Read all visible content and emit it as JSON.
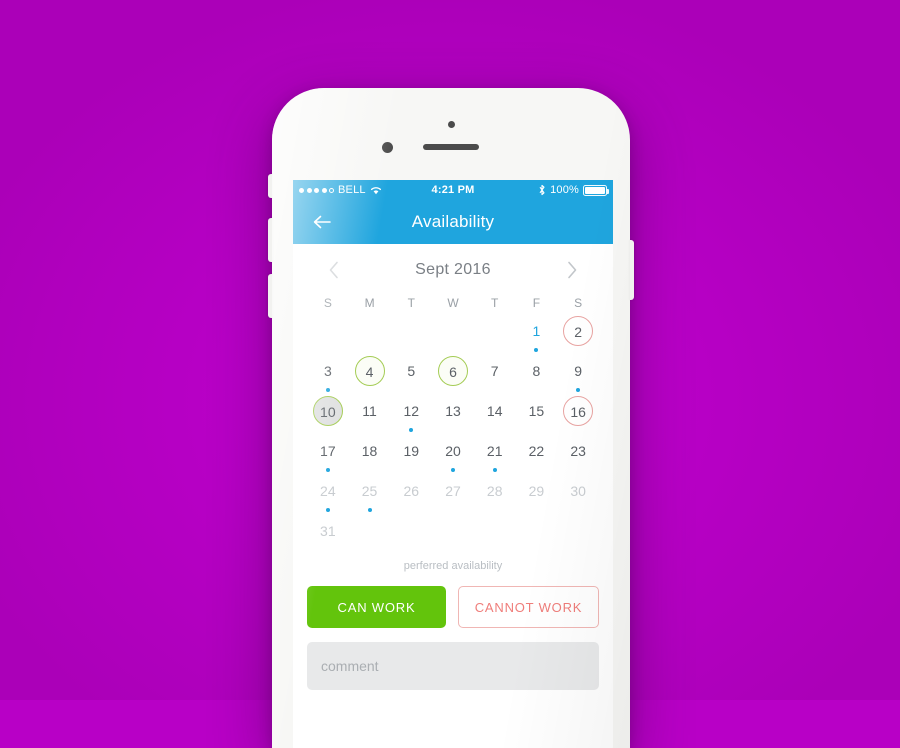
{
  "theme": {
    "background": "#b800c6",
    "accent_blue": "#1fa5de",
    "green": "#63c40c",
    "ring_green": "#a4cc54",
    "ring_red": "#e8a3a1",
    "red_text": "#ef7d7a"
  },
  "status_bar": {
    "carrier": "BELL",
    "signal_filled": 4,
    "signal_hollow": 1,
    "wifi_icon": "wifi-icon",
    "time": "4:21 PM",
    "bluetooth_icon": "bluetooth-icon",
    "battery_percent": "100%",
    "battery_icon": "battery-full-icon"
  },
  "nav_bar": {
    "back_icon": "arrow-left-icon",
    "title": "Availability"
  },
  "calendar": {
    "prev_icon": "chevron-left-icon",
    "next_icon": "chevron-right-icon",
    "month_label": "Sept 2016",
    "weekdays": [
      "S",
      "M",
      "T",
      "W",
      "T",
      "F",
      "S"
    ],
    "legend": "perferred availability",
    "days": [
      {
        "num": "",
        "blank": true
      },
      {
        "num": "",
        "blank": true
      },
      {
        "num": "",
        "blank": true
      },
      {
        "num": "",
        "blank": true
      },
      {
        "num": "",
        "blank": true
      },
      {
        "num": "1",
        "style": "blue",
        "dot": true
      },
      {
        "num": "2",
        "style": "ring-red"
      },
      {
        "num": "3",
        "style": "normal",
        "dot": true
      },
      {
        "num": "4",
        "style": "ring-green"
      },
      {
        "num": "5",
        "style": "normal"
      },
      {
        "num": "6",
        "style": "ring-green"
      },
      {
        "num": "7",
        "style": "normal"
      },
      {
        "num": "8",
        "style": "normal"
      },
      {
        "num": "9",
        "style": "normal",
        "dot": true
      },
      {
        "num": "10",
        "style": "ring-green selected"
      },
      {
        "num": "11",
        "style": "normal"
      },
      {
        "num": "12",
        "style": "normal",
        "dot": true
      },
      {
        "num": "13",
        "style": "normal"
      },
      {
        "num": "14",
        "style": "normal"
      },
      {
        "num": "15",
        "style": "normal"
      },
      {
        "num": "16",
        "style": "ring-red"
      },
      {
        "num": "17",
        "style": "normal",
        "dot": true
      },
      {
        "num": "18",
        "style": "normal"
      },
      {
        "num": "19",
        "style": "normal"
      },
      {
        "num": "20",
        "style": "normal",
        "dot": true
      },
      {
        "num": "21",
        "style": "normal",
        "dot": true
      },
      {
        "num": "22",
        "style": "normal"
      },
      {
        "num": "23",
        "style": "normal"
      },
      {
        "num": "24",
        "style": "muted",
        "dot": true
      },
      {
        "num": "25",
        "style": "muted",
        "dot": true
      },
      {
        "num": "26",
        "style": "muted"
      },
      {
        "num": "27",
        "style": "muted"
      },
      {
        "num": "28",
        "style": "muted"
      },
      {
        "num": "29",
        "style": "muted"
      },
      {
        "num": "30",
        "style": "muted"
      },
      {
        "num": "31",
        "style": "muted"
      },
      {
        "num": "",
        "blank": true
      },
      {
        "num": "",
        "blank": true
      },
      {
        "num": "",
        "blank": true
      },
      {
        "num": "",
        "blank": true
      },
      {
        "num": "",
        "blank": true
      },
      {
        "num": "",
        "blank": true
      }
    ]
  },
  "actions": {
    "can_work_label": "CAN WORK",
    "cannot_work_label": "CANNOT WORK"
  },
  "comment": {
    "placeholder": "comment",
    "value": ""
  },
  "phone_hardware": {
    "sensor": "proximity-sensor",
    "camera": "front-camera",
    "speaker": "earpiece-speaker",
    "silent_switch": "silent-switch",
    "volume_up": "volume-up-button",
    "volume_down": "volume-down-button",
    "power": "power-button"
  }
}
